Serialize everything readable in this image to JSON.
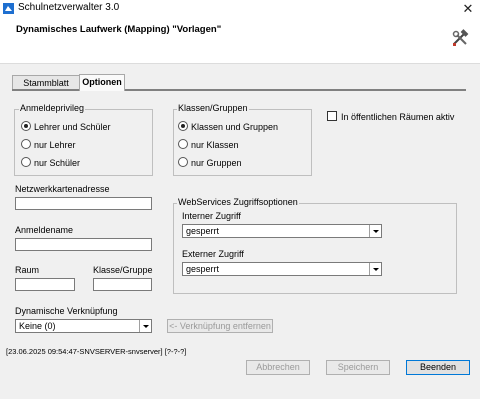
{
  "window": {
    "title": "Schulnetzverwalter 3.0",
    "close_glyph": "✕",
    "app_icon": "app-icon",
    "tools_icon": "hammer-wrench-icon"
  },
  "header": {
    "title": "Dynamisches Laufwerk (Mapping) \"Vorlagen\""
  },
  "tabs": [
    {
      "label": "Stammblatt",
      "active": false
    },
    {
      "label": "Optionen",
      "active": true
    }
  ],
  "anmeldeprivileg": {
    "label": "Anmeldeprivileg",
    "options": [
      {
        "label": "Lehrer und Schüler",
        "selected": true
      },
      {
        "label": "nur Lehrer",
        "selected": false
      },
      {
        "label": "nur Schüler",
        "selected": false
      }
    ]
  },
  "klassen_gruppen": {
    "label": "Klassen/Gruppen",
    "options": [
      {
        "label": "Klassen und Gruppen",
        "selected": true
      },
      {
        "label": "nur Klassen",
        "selected": false
      },
      {
        "label": "nur Gruppen",
        "selected": false
      }
    ]
  },
  "oeffentliche_raeume": {
    "label": "In öffentlichen Räumen aktiv",
    "checked": false
  },
  "fields": {
    "netzwerkkartenadresse": {
      "label": "Netzwerkkartenadresse",
      "value": ""
    },
    "anmeldename": {
      "label": "Anmeldename",
      "value": ""
    },
    "raum": {
      "label": "Raum",
      "value": ""
    },
    "klasse_gruppe": {
      "label": "Klasse/Gruppe",
      "value": ""
    }
  },
  "webservices": {
    "label": "WebServices Zugriffsoptionen",
    "intern": {
      "label": "Interner Zugriff",
      "value": "gesperrt"
    },
    "extern": {
      "label": "Externer Zugriff",
      "value": "gesperrt"
    }
  },
  "verknuepfung": {
    "label": "Dynamische Verknüpfung",
    "value": "Keine (0)",
    "remove_button": "<- Verknüpfung entfernen"
  },
  "status": {
    "text": "[23.06.2025 09:54:47-SNVSERVER-snvserver] [?-?-?]"
  },
  "buttons": {
    "abbrechen": "Abbrechen",
    "speichern": "Speichern",
    "beenden": "Beenden"
  },
  "colors": {
    "focus_border": "#0078d7",
    "tab_strip": "#808080",
    "app_icon_blue": "#1e6fd0"
  }
}
